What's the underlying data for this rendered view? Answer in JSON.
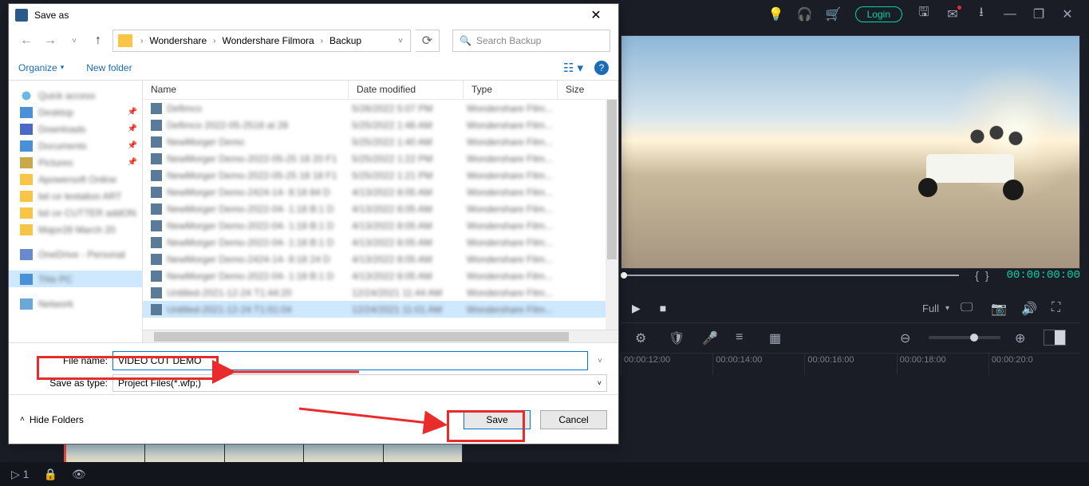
{
  "titlebar": {
    "login": "Login"
  },
  "preview": {
    "brackets_left": "{",
    "brackets_right": "}",
    "timecode": "00:00:00:00"
  },
  "quality_label": "Full",
  "ruler": [
    "00:00:12:00",
    "00:00:14:00",
    "00:00:16:00",
    "00:00:18:00",
    "00:00:20:0"
  ],
  "bottombar": {
    "trackcount": "1"
  },
  "dialog": {
    "title": "Save as",
    "breadcrumb": [
      "Wondershare",
      "Wondershare Filmora",
      "Backup"
    ],
    "search_placeholder": "Search Backup",
    "organize": "Organize",
    "new_folder": "New folder",
    "columns": {
      "name": "Name",
      "date": "Date modified",
      "type": "Type",
      "size": "Size"
    },
    "sidebar": {
      "quick": "Quick access",
      "desktop": "Desktop",
      "downloads": "Downloads",
      "documents": "Documents",
      "pictures": "Pictures",
      "f1": "Apowersoft Online",
      "f2": "bd ce textation ART",
      "f3": "bd ce CUTTER addON",
      "f4": "Major28 March 20",
      "onedrive": "OneDrive - Personal",
      "thispc": "This PC",
      "network": "Network"
    },
    "files": [
      {
        "n": "Defimco",
        "d": "5/26/2022 5:07 PM",
        "t": "Wondershare Film..."
      },
      {
        "n": "Defimco 2022-05-2518 at 28",
        "d": "5/25/2022 1:46 AM",
        "t": "Wondershare Film..."
      },
      {
        "n": "NewMorger Demo",
        "d": "5/25/2022 1:40 AM",
        "t": "Wondershare Film..."
      },
      {
        "n": "NewMorger Demo-2022-05-25 18 20 F1",
        "d": "5/25/2022 1:22 PM",
        "t": "Wondershare Film..."
      },
      {
        "n": "NewMorger Demo-2022-05-25 18 18 F1",
        "d": "5/25/2022 1:21 PM",
        "t": "Wondershare Film..."
      },
      {
        "n": "NewMorger Demo-2424-14- 8:18 84 D",
        "d": "4/13/2022 8:05 AM",
        "t": "Wondershare Film..."
      },
      {
        "n": "NewMorger Demo-2022-04- 1:18 B:1 D",
        "d": "4/13/2022 8:05 AM",
        "t": "Wondershare Film..."
      },
      {
        "n": "NewMorger Demo-2022-04- 1:18 B:1 D",
        "d": "4/13/2022 8:05 AM",
        "t": "Wondershare Film..."
      },
      {
        "n": "NewMorger Demo-2022-04- 1:18 B:1 D",
        "d": "4/13/2022 8:05 AM",
        "t": "Wondershare Film..."
      },
      {
        "n": "NewMorger Demo-2424-14- 8:18 24 D",
        "d": "4/13/2022 8:05 AM",
        "t": "Wondershare Film..."
      },
      {
        "n": "NewMorger Demo-2022-04- 1:18 B:1 D",
        "d": "4/13/2022 8:05 AM",
        "t": "Wondershare Film..."
      },
      {
        "n": "Untitled-2021-12-24 T1:44:20",
        "d": "12/24/2021 11:44 AM",
        "t": "Wondershare Film..."
      },
      {
        "n": "Untitled-2021-12-24 T1:01:04",
        "d": "12/24/2021 11:01 AM",
        "t": "Wondershare Film..."
      }
    ],
    "filename_label": "File name:",
    "filename_value": "VIDEO CUT DEMO",
    "saveastype_label": "Save as type:",
    "saveastype_value": "Project Files(*.wfp;)",
    "hide_folders": "Hide Folders",
    "save_btn": "Save",
    "cancel_btn": "Cancel"
  }
}
